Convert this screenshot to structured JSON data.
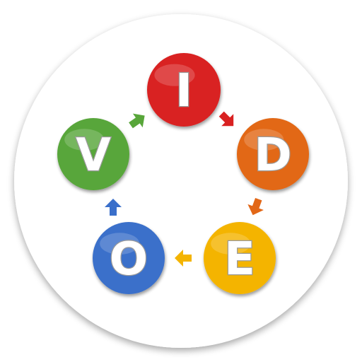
{
  "icon": {
    "name": "vidoe-cycle-logo",
    "background": "#ffffff",
    "shadow": "#bdbdbd",
    "nodes": [
      {
        "letter": "I",
        "color": "#d92121"
      },
      {
        "letter": "D",
        "color": "#e26717"
      },
      {
        "letter": "E",
        "color": "#f4b400"
      },
      {
        "letter": "O",
        "color": "#3a6fca"
      },
      {
        "letter": "V",
        "color": "#58a63a"
      }
    ],
    "arrows": [
      {
        "color": "#d92121"
      },
      {
        "color": "#e26717"
      },
      {
        "color": "#f4b400"
      },
      {
        "color": "#3a6fca"
      },
      {
        "color": "#58a63a"
      }
    ]
  }
}
